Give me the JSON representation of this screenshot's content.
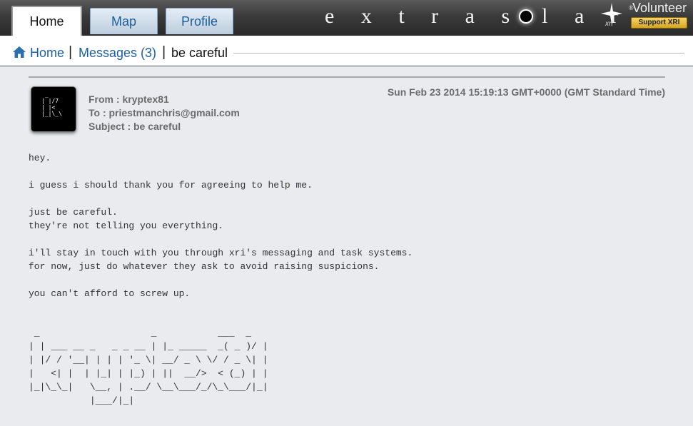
{
  "nav": {
    "tabs": [
      {
        "label": "Home",
        "active": true
      },
      {
        "label": "Map",
        "active": false
      },
      {
        "label": "Profile",
        "active": false
      }
    ],
    "logo_text": "extrasolar",
    "logo_mark": "®",
    "xri_label": "xri",
    "volunteer_label": "Volunteer",
    "support_button": "Support XRI"
  },
  "breadcrumb": {
    "home": "Home",
    "separator": "|",
    "messages": "Messages (3)",
    "current": "be careful"
  },
  "message": {
    "from": "From : kryptex81",
    "to": "To : priestmanchris@gmail.com",
    "subject": "Subject : be careful",
    "date": "Sun Feb 23 2014 15:19:13 GMT+0000 (GMT Standard Time)",
    "avatar_art": " _\n| |/7\n| |<\n|_|\\_\\",
    "body": "hey.\n\ni guess i should thank you for agreeing to help me.\n\njust be careful.\nthey're not telling you everything.\n\ni'll stay in touch with you through xri's messaging and task systems.\nfor now, just do whatever they ask to avoid raising suspicions.\n\nyou can't afford to screw up.",
    "ascii_signature": " _                    _           ___  _\n| | ___ __ _   _ _ __ | |_ _____  _( _ )/ |\n| |/ / '__| | | | '_ \\| __/ _ \\ \\/ / _ \\| |\n|   <| |  | |_| | |_) | ||  __/>  < (_) | |\n|_|\\_\\_|   \\__, | .__/ \\__\\___/_/\\_\\___/|_|\n           |___/|_|"
  },
  "colors": {
    "link": "#1f5e9a",
    "meta_text": "#6b6b6b",
    "support_gold": "#e2b73c"
  }
}
